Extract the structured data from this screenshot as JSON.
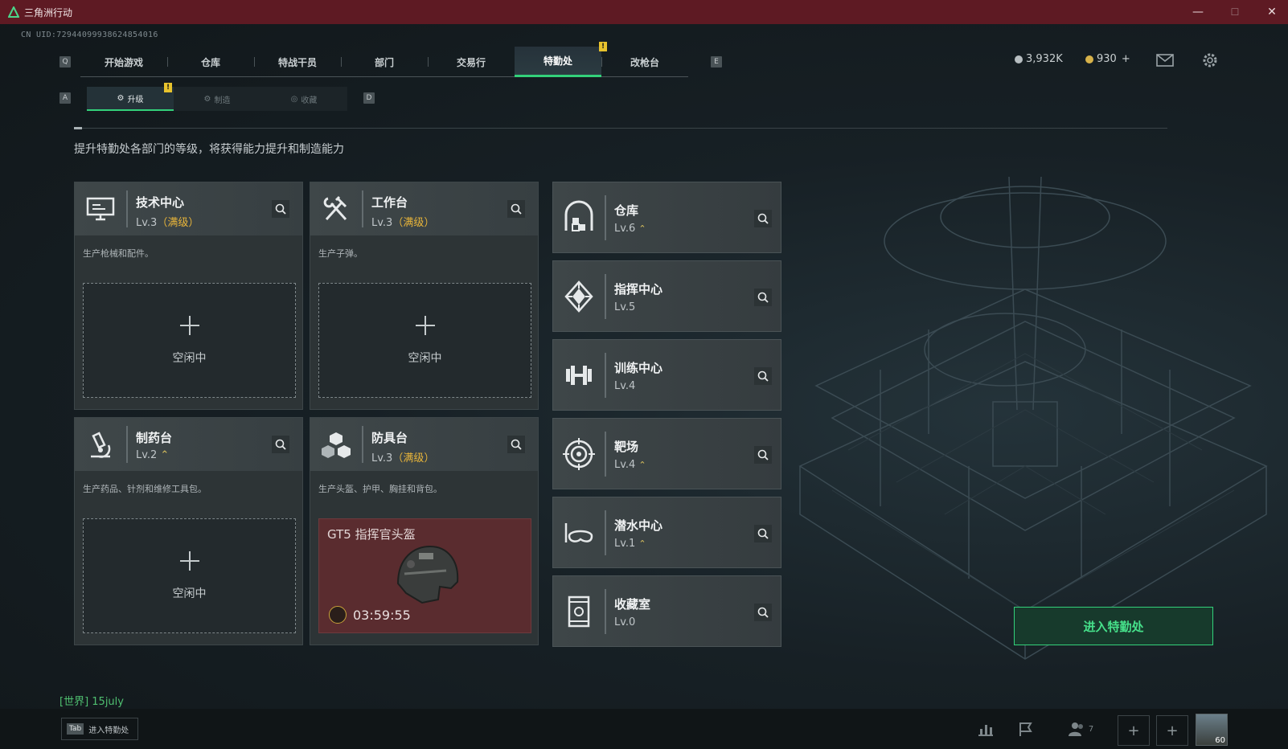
{
  "window": {
    "title": "三角洲行动",
    "minimize": "—",
    "maximize": "☐",
    "close": "✕"
  },
  "uid": "CN UID:72944099938624854016",
  "top_nav": {
    "left_key": "Q",
    "right_key": "E",
    "tabs": [
      "开始游戏",
      "仓库",
      "特战干员",
      "部门",
      "交易行",
      "特勤处",
      "改枪台"
    ],
    "active": "特勤处",
    "alert": "!"
  },
  "currency": {
    "silver": "3,932K",
    "gold": "930",
    "gold_add": "+"
  },
  "sub_nav": {
    "left_key": "A",
    "right_key": "D",
    "tabs": [
      "升级",
      "制造",
      "收藏"
    ],
    "active": "升级",
    "alert": "!"
  },
  "description": "提升特勤处各部门的等级，将获得能力提升和制造能力",
  "departments": [
    {
      "name": "技术中心",
      "level": "Lv.3",
      "max_label": "（满级）",
      "sub": "生产枪械和配件。",
      "slot": "空闲中",
      "icon": "monitor-icon"
    },
    {
      "name": "工作台",
      "level": "Lv.3",
      "max_label": "（满级）",
      "sub": "生产子弹。",
      "slot": "空闲中",
      "icon": "hammer-wrench-icon"
    },
    {
      "name": "制药台",
      "level": "Lv.2",
      "upgrade": "⌃",
      "sub": "生产药品、针剂和维修工具包。",
      "slot": "空闲中",
      "icon": "microscope-icon"
    },
    {
      "name": "防具台",
      "level": "Lv.3",
      "max_label": "（满级）",
      "sub": "生产头盔、护甲、胸挂和背包。",
      "craft_item": "GT5 指挥官头盔",
      "craft_timer": "03:59:55",
      "icon": "cubes-icon"
    }
  ],
  "facilities": [
    {
      "name": "仓库",
      "level": "Lv.6",
      "upgrade": "⌃",
      "icon": "warehouse-icon"
    },
    {
      "name": "指挥中心",
      "level": "Lv.5",
      "icon": "command-center-icon"
    },
    {
      "name": "训练中心",
      "level": "Lv.4",
      "icon": "dumbbell-icon"
    },
    {
      "name": "靶场",
      "level": "Lv.4",
      "upgrade": "⌃",
      "icon": "target-icon"
    },
    {
      "name": "潜水中心",
      "level": "Lv.1",
      "upgrade": "⌃",
      "icon": "dive-mask-icon"
    },
    {
      "name": "收藏室",
      "level": "Lv.0",
      "icon": "collection-icon"
    }
  ],
  "enter_button": "进入特勤处",
  "chat": "[世界] 15july",
  "bottom": {
    "tab_key": "Tab",
    "tab_label": "进入特勤处",
    "friends_count": "7",
    "avatar_level": "60"
  },
  "colors": {
    "accent": "#33d17a",
    "titlebar": "#5e1a23",
    "max_level": "#e8b53a"
  }
}
